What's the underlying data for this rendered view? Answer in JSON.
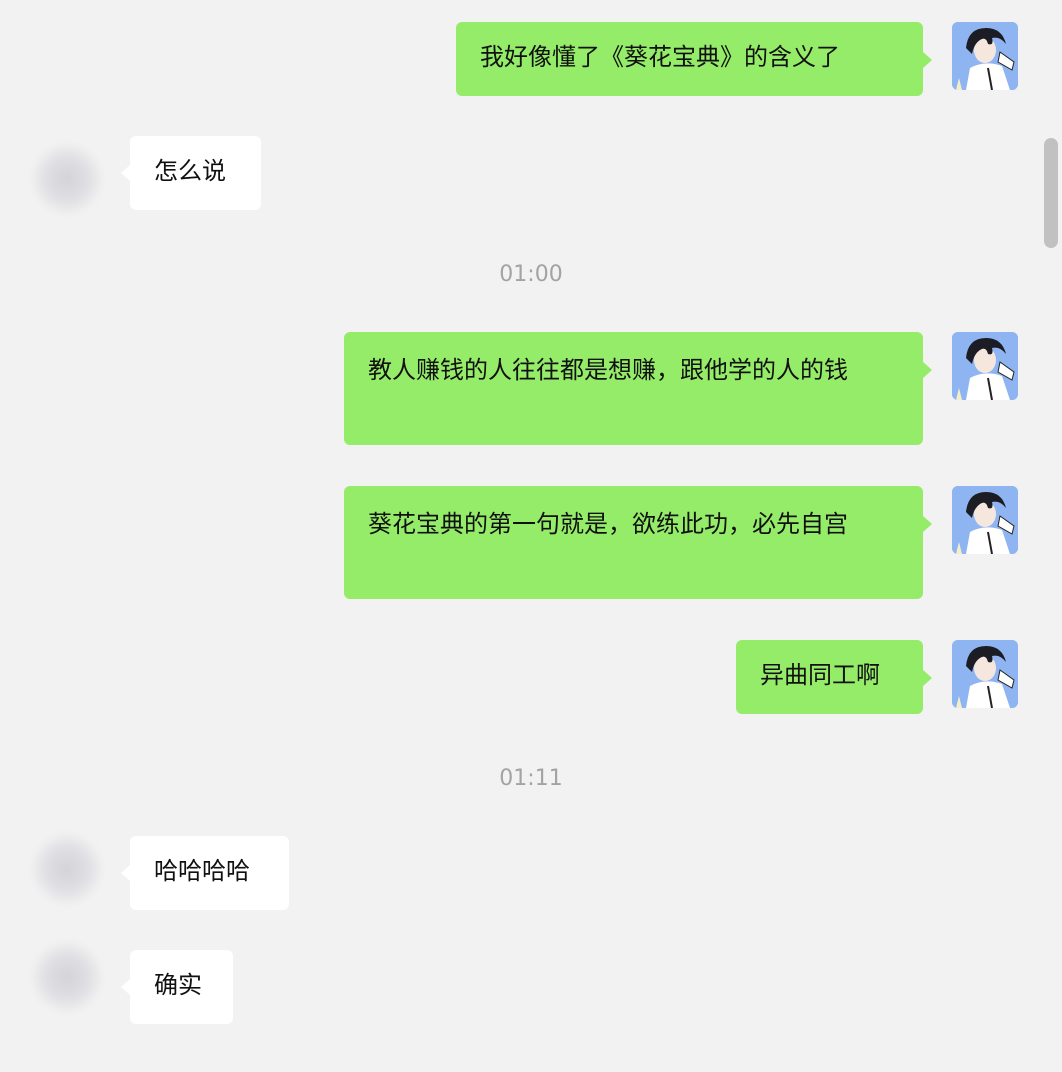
{
  "messages": [
    {
      "text": "我好像懂了《葵花宝典》的含义了"
    },
    {
      "text": "怎么说"
    },
    {
      "text": "教人赚钱的人往往都是想赚，跟他学的人的钱"
    },
    {
      "text": "葵花宝典的第一句就是，欲练此功，必先自宫"
    },
    {
      "text": "异曲同工啊"
    },
    {
      "text": "哈哈哈哈"
    },
    {
      "text": "确实"
    }
  ],
  "timestamps": [
    "01:00",
    "01:11"
  ],
  "colors": {
    "background": "#f2f2f2",
    "outgoing_bubble": "#95ec69",
    "incoming_bubble": "#ffffff",
    "timestamp_text": "#a3a3a3"
  },
  "icons": {
    "self_avatar": "anime-boy-avatar-icon",
    "other_avatar": "blurred-avatar-icon"
  }
}
